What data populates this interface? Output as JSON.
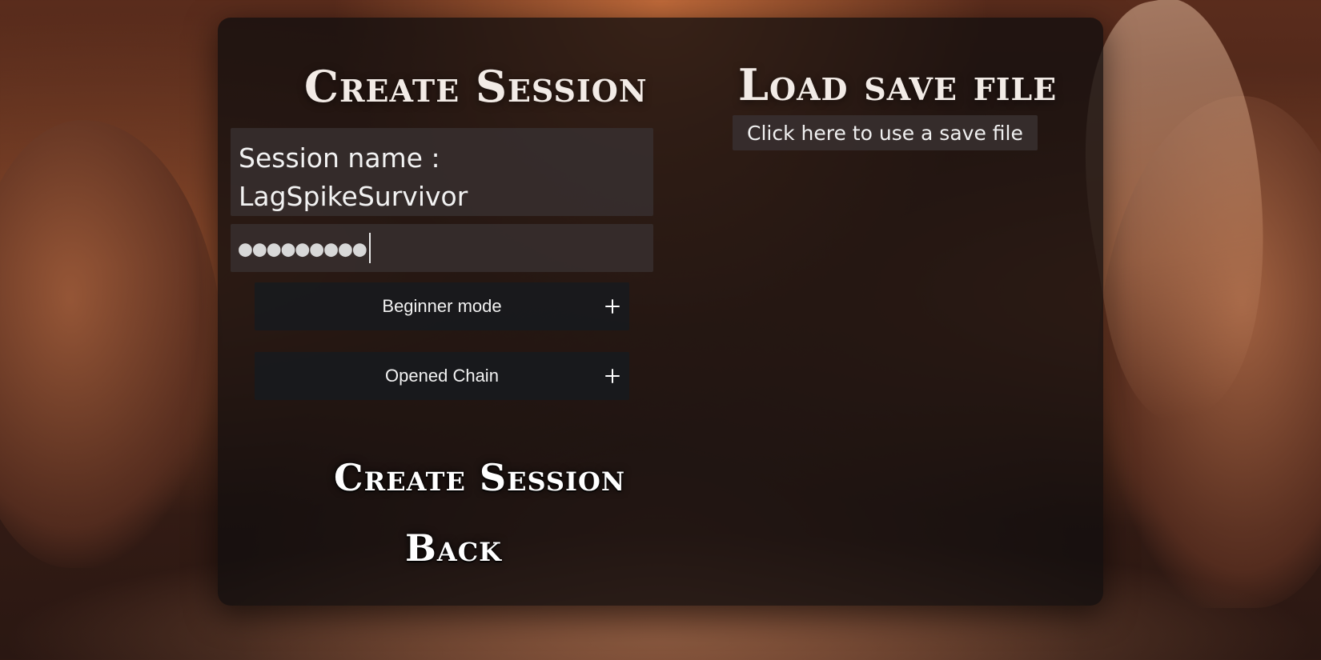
{
  "colors": {
    "panel_bg": "#120e0e",
    "title_text": "#f2ebe6",
    "field_bg": "#372f2f",
    "button_bg": "#181a1d",
    "text": "#f2f2f2"
  },
  "left": {
    "title": "Create Session",
    "session_name": {
      "label": "Session name :",
      "value": "LagSpikeSurvivor"
    },
    "password": {
      "masked_value": "●●●●●●●●●"
    },
    "options": [
      {
        "label": "Beginner mode",
        "icon": "plus-icon"
      },
      {
        "label": "Opened Chain",
        "icon": "plus-icon"
      }
    ],
    "create_label": "Create Session",
    "back_label": "Back"
  },
  "right": {
    "title": "Load save file",
    "save_button_label": "Click here to use a save file"
  }
}
